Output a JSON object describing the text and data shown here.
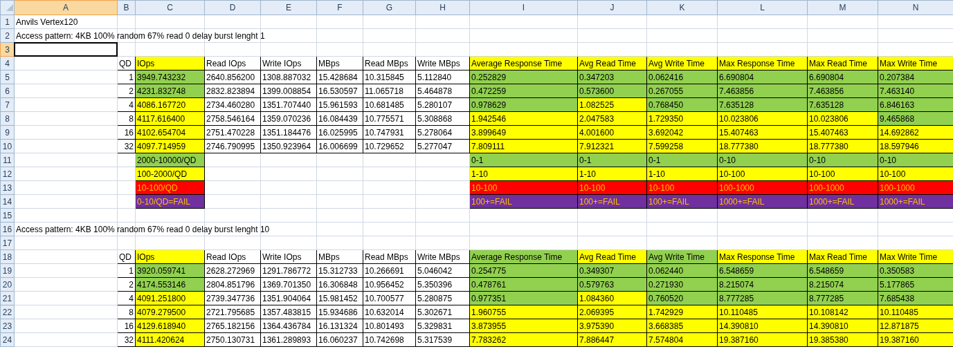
{
  "columns": [
    {
      "label": "A",
      "selected": true
    },
    {
      "label": "B",
      "selected": false
    },
    {
      "label": "C",
      "selected": false
    },
    {
      "label": "D",
      "selected": false
    },
    {
      "label": "E",
      "selected": false
    },
    {
      "label": "F",
      "selected": false
    },
    {
      "label": "G",
      "selected": false
    },
    {
      "label": "H",
      "selected": false
    },
    {
      "label": "I",
      "selected": false
    },
    {
      "label": "J",
      "selected": false
    },
    {
      "label": "K",
      "selected": false
    },
    {
      "label": "L",
      "selected": false
    },
    {
      "label": "M",
      "selected": false
    },
    {
      "label": "N",
      "selected": false
    }
  ],
  "rows": [
    {
      "label": "1",
      "selected": false,
      "cells": {
        "A": {
          "text": "Anvils Vertex120"
        }
      }
    },
    {
      "label": "2",
      "selected": false,
      "cells": {
        "A": {
          "text": "Access pattern: 4KB 100% random 67% read 0 delay burst lenght 1"
        }
      }
    },
    {
      "label": "3",
      "selected": true,
      "cells": {
        "A": {
          "selected": true
        }
      }
    },
    {
      "label": "4",
      "selected": false,
      "cells": {
        "B": {
          "text": "QD",
          "bordered": true
        },
        "C": {
          "text": "IOps",
          "bordered": true,
          "color": "#ffff00"
        },
        "D": {
          "text": "Read IOps",
          "bordered": true
        },
        "E": {
          "text": "Write IOps",
          "bordered": true
        },
        "F": {
          "text": "MBps",
          "bordered": true
        },
        "G": {
          "text": "Read MBps",
          "bordered": true
        },
        "H": {
          "text": "Write MBps",
          "bordered": true
        },
        "I": {
          "text": "Average Response Time",
          "bordered": true,
          "color": "#ffff00"
        },
        "J": {
          "text": "Avg Read Time",
          "bordered": true,
          "color": "#ffff00"
        },
        "K": {
          "text": "Avg Write Time",
          "bordered": true,
          "color": "#ffff00"
        },
        "L": {
          "text": "Max Response Time",
          "bordered": true,
          "color": "#ffff00"
        },
        "M": {
          "text": "Max Read Time",
          "bordered": true,
          "color": "#ffff00"
        },
        "N": {
          "text": "Max Write Time",
          "bordered": true,
          "color": "#ffff00"
        }
      }
    },
    {
      "label": "5",
      "selected": false,
      "cells": {
        "B": {
          "text": "1",
          "bordered": true,
          "kind": "number"
        },
        "C": {
          "text": "3949.743232",
          "bordered": true,
          "color": "#92d050"
        },
        "D": {
          "text": "2640.856200",
          "bordered": true
        },
        "E": {
          "text": "1308.887032",
          "bordered": true
        },
        "F": {
          "text": "15.428684",
          "bordered": true
        },
        "G": {
          "text": "10.315845",
          "bordered": true
        },
        "H": {
          "text": "5.112840",
          "bordered": true
        },
        "I": {
          "text": "0.252829",
          "bordered": true,
          "color": "#92d050"
        },
        "J": {
          "text": "0.347203",
          "bordered": true,
          "color": "#92d050"
        },
        "K": {
          "text": "0.062416",
          "bordered": true,
          "color": "#92d050"
        },
        "L": {
          "text": "6.690804",
          "bordered": true,
          "color": "#92d050"
        },
        "M": {
          "text": "6.690804",
          "bordered": true,
          "color": "#92d050"
        },
        "N": {
          "text": "0.207384",
          "bordered": true,
          "color": "#92d050"
        }
      }
    },
    {
      "label": "6",
      "selected": false,
      "cells": {
        "B": {
          "text": "2",
          "bordered": true,
          "kind": "number"
        },
        "C": {
          "text": "4231.832748",
          "bordered": true,
          "color": "#92d050"
        },
        "D": {
          "text": "2832.823894",
          "bordered": true
        },
        "E": {
          "text": "1399.008854",
          "bordered": true
        },
        "F": {
          "text": "16.530597",
          "bordered": true
        },
        "G": {
          "text": "11.065718",
          "bordered": true
        },
        "H": {
          "text": "5.464878",
          "bordered": true
        },
        "I": {
          "text": "0.472259",
          "bordered": true,
          "color": "#92d050"
        },
        "J": {
          "text": "0.573600",
          "bordered": true,
          "color": "#92d050"
        },
        "K": {
          "text": "0.267055",
          "bordered": true,
          "color": "#92d050"
        },
        "L": {
          "text": "7.463856",
          "bordered": true,
          "color": "#92d050"
        },
        "M": {
          "text": "7.463856",
          "bordered": true,
          "color": "#92d050"
        },
        "N": {
          "text": "7.463140",
          "bordered": true,
          "color": "#92d050"
        }
      }
    },
    {
      "label": "7",
      "selected": false,
      "cells": {
        "B": {
          "text": "4",
          "bordered": true,
          "kind": "number"
        },
        "C": {
          "text": "4086.167720",
          "bordered": true,
          "color": "#ffff00"
        },
        "D": {
          "text": "2734.460280",
          "bordered": true
        },
        "E": {
          "text": "1351.707440",
          "bordered": true
        },
        "F": {
          "text": "15.961593",
          "bordered": true
        },
        "G": {
          "text": "10.681485",
          "bordered": true
        },
        "H": {
          "text": "5.280107",
          "bordered": true
        },
        "I": {
          "text": "0.978629",
          "bordered": true,
          "color": "#92d050"
        },
        "J": {
          "text": "1.082525",
          "bordered": true,
          "color": "#ffff00"
        },
        "K": {
          "text": "0.768450",
          "bordered": true,
          "color": "#92d050"
        },
        "L": {
          "text": "7.635128",
          "bordered": true,
          "color": "#92d050"
        },
        "M": {
          "text": "7.635128",
          "bordered": true,
          "color": "#92d050"
        },
        "N": {
          "text": "6.846163",
          "bordered": true,
          "color": "#92d050"
        }
      }
    },
    {
      "label": "8",
      "selected": false,
      "cells": {
        "B": {
          "text": "8",
          "bordered": true,
          "kind": "number"
        },
        "C": {
          "text": "4117.616400",
          "bordered": true,
          "color": "#ffff00"
        },
        "D": {
          "text": "2758.546164",
          "bordered": true
        },
        "E": {
          "text": "1359.070236",
          "bordered": true
        },
        "F": {
          "text": "16.084439",
          "bordered": true
        },
        "G": {
          "text": "10.775571",
          "bordered": true
        },
        "H": {
          "text": "5.308868",
          "bordered": true
        },
        "I": {
          "text": "1.942546",
          "bordered": true,
          "color": "#ffff00"
        },
        "J": {
          "text": "2.047583",
          "bordered": true,
          "color": "#ffff00"
        },
        "K": {
          "text": "1.729350",
          "bordered": true,
          "color": "#ffff00"
        },
        "L": {
          "text": "10.023806",
          "bordered": true,
          "color": "#ffff00"
        },
        "M": {
          "text": "10.023806",
          "bordered": true,
          "color": "#ffff00"
        },
        "N": {
          "text": "9.465868",
          "bordered": true,
          "color": "#92d050"
        }
      }
    },
    {
      "label": "9",
      "selected": false,
      "cells": {
        "B": {
          "text": "16",
          "bordered": true,
          "kind": "number"
        },
        "C": {
          "text": "4102.654704",
          "bordered": true,
          "color": "#ffff00"
        },
        "D": {
          "text": "2751.470228",
          "bordered": true
        },
        "E": {
          "text": "1351.184476",
          "bordered": true
        },
        "F": {
          "text": "16.025995",
          "bordered": true
        },
        "G": {
          "text": "10.747931",
          "bordered": true
        },
        "H": {
          "text": "5.278064",
          "bordered": true
        },
        "I": {
          "text": "3.899649",
          "bordered": true,
          "color": "#ffff00"
        },
        "J": {
          "text": "4.001600",
          "bordered": true,
          "color": "#ffff00"
        },
        "K": {
          "text": "3.692042",
          "bordered": true,
          "color": "#ffff00"
        },
        "L": {
          "text": "15.407463",
          "bordered": true,
          "color": "#ffff00"
        },
        "M": {
          "text": "15.407463",
          "bordered": true,
          "color": "#ffff00"
        },
        "N": {
          "text": "14.692862",
          "bordered": true,
          "color": "#ffff00"
        }
      }
    },
    {
      "label": "10",
      "selected": false,
      "cells": {
        "B": {
          "text": "32",
          "bordered": true,
          "kind": "number"
        },
        "C": {
          "text": "4097.714959",
          "bordered": true,
          "color": "#ffff00"
        },
        "D": {
          "text": "2746.790995",
          "bordered": true
        },
        "E": {
          "text": "1350.923964",
          "bordered": true
        },
        "F": {
          "text": "16.006699",
          "bordered": true
        },
        "G": {
          "text": "10.729652",
          "bordered": true
        },
        "H": {
          "text": "5.277047",
          "bordered": true
        },
        "I": {
          "text": "7.809111",
          "bordered": true,
          "color": "#ffff00"
        },
        "J": {
          "text": "7.912321",
          "bordered": true,
          "color": "#ffff00"
        },
        "K": {
          "text": "7.599258",
          "bordered": true,
          "color": "#ffff00"
        },
        "L": {
          "text": "18.777380",
          "bordered": true,
          "color": "#ffff00"
        },
        "M": {
          "text": "18.777380",
          "bordered": true,
          "color": "#ffff00"
        },
        "N": {
          "text": "18.597946",
          "bordered": true,
          "color": "#ffff00"
        }
      }
    },
    {
      "label": "11",
      "selected": false,
      "cells": {
        "C": {
          "text": "2000-10000/QD",
          "bordered": true,
          "color": "#92d050"
        },
        "I": {
          "text": "0-1",
          "bordered": true,
          "color": "#92d050"
        },
        "J": {
          "text": "0-1",
          "bordered": true,
          "color": "#92d050"
        },
        "K": {
          "text": "0-1",
          "bordered": true,
          "color": "#92d050"
        },
        "L": {
          "text": "0-10",
          "bordered": true,
          "color": "#92d050"
        },
        "M": {
          "text": "0-10",
          "bordered": true,
          "color": "#92d050"
        },
        "N": {
          "text": "0-10",
          "bordered": true,
          "color": "#92d050"
        }
      }
    },
    {
      "label": "12",
      "selected": false,
      "cells": {
        "C": {
          "text": "100-2000/QD",
          "bordered": true,
          "color": "#ffff00"
        },
        "I": {
          "text": "1-10",
          "bordered": true,
          "color": "#ffff00"
        },
        "J": {
          "text": "1-10",
          "bordered": true,
          "color": "#ffff00"
        },
        "K": {
          "text": "1-10",
          "bordered": true,
          "color": "#ffff00"
        },
        "L": {
          "text": "10-100",
          "bordered": true,
          "color": "#ffff00"
        },
        "M": {
          "text": "10-100",
          "bordered": true,
          "color": "#ffff00"
        },
        "N": {
          "text": "10-100",
          "bordered": true,
          "color": "#ffff00"
        }
      }
    },
    {
      "label": "13",
      "selected": false,
      "cells": {
        "C": {
          "text": "10-100/QD",
          "bordered": true,
          "color": "#ff0000"
        },
        "I": {
          "text": "10-100",
          "bordered": true,
          "color": "#ff0000"
        },
        "J": {
          "text": "10-100",
          "bordered": true,
          "color": "#ff0000"
        },
        "K": {
          "text": "10-100",
          "bordered": true,
          "color": "#ff0000"
        },
        "L": {
          "text": "100-1000",
          "bordered": true,
          "color": "#ff0000"
        },
        "M": {
          "text": "100-1000",
          "bordered": true,
          "color": "#ff0000"
        },
        "N": {
          "text": "100-1000",
          "bordered": true,
          "color": "#ff0000"
        }
      }
    },
    {
      "label": "14",
      "selected": false,
      "cells": {
        "C": {
          "text": "0-10/QD=FAIL",
          "bordered": true,
          "color": "#7030a0"
        },
        "I": {
          "text": "100+=FAIL",
          "bordered": true,
          "color": "#7030a0"
        },
        "J": {
          "text": "100+=FAIL",
          "bordered": true,
          "color": "#7030a0"
        },
        "K": {
          "text": "100+=FAIL",
          "bordered": true,
          "color": "#7030a0"
        },
        "L": {
          "text": "1000+=FAIL",
          "bordered": true,
          "color": "#7030a0"
        },
        "M": {
          "text": "1000+=FAIL",
          "bordered": true,
          "color": "#7030a0"
        },
        "N": {
          "text": "1000+=FAIL",
          "bordered": true,
          "color": "#7030a0"
        }
      }
    },
    {
      "label": "15",
      "selected": false,
      "cells": {}
    },
    {
      "label": "16",
      "selected": false,
      "cells": {
        "A": {
          "text": "Access pattern: 4KB 100% random 67% read 0 delay burst lenght 10"
        }
      }
    },
    {
      "label": "17",
      "selected": false,
      "cells": {}
    },
    {
      "label": "18",
      "selected": false,
      "cells": {
        "B": {
          "text": "QD",
          "bordered": true
        },
        "C": {
          "text": "IOps",
          "bordered": true,
          "color": "#ffff00"
        },
        "D": {
          "text": "Read IOps",
          "bordered": true
        },
        "E": {
          "text": "Write IOps",
          "bordered": true
        },
        "F": {
          "text": "MBps",
          "bordered": true
        },
        "G": {
          "text": "Read MBps",
          "bordered": true
        },
        "H": {
          "text": "Write MBps",
          "bordered": true
        },
        "I": {
          "text": "Average Response Time",
          "bordered": true,
          "color": "#92d050"
        },
        "J": {
          "text": "Avg Read Time",
          "bordered": true,
          "color": "#ffff00"
        },
        "K": {
          "text": "Avg Write Time",
          "bordered": true,
          "color": "#92d050"
        },
        "L": {
          "text": "Max Response Time",
          "bordered": true,
          "color": "#ffff00"
        },
        "M": {
          "text": "Max Read Time",
          "bordered": true,
          "color": "#ffff00"
        },
        "N": {
          "text": "Max Write Time",
          "bordered": true,
          "color": "#ffff00"
        }
      }
    },
    {
      "label": "19",
      "selected": false,
      "cells": {
        "B": {
          "text": "1",
          "bordered": true,
          "kind": "number"
        },
        "C": {
          "text": "3920.059741",
          "bordered": true,
          "color": "#92d050"
        },
        "D": {
          "text": "2628.272969",
          "bordered": true
        },
        "E": {
          "text": "1291.786772",
          "bordered": true
        },
        "F": {
          "text": "15.312733",
          "bordered": true
        },
        "G": {
          "text": "10.266691",
          "bordered": true
        },
        "H": {
          "text": "5.046042",
          "bordered": true
        },
        "I": {
          "text": "0.254775",
          "bordered": true,
          "color": "#92d050"
        },
        "J": {
          "text": "0.349307",
          "bordered": true,
          "color": "#92d050"
        },
        "K": {
          "text": "0.062440",
          "bordered": true,
          "color": "#92d050"
        },
        "L": {
          "text": "6.548659",
          "bordered": true,
          "color": "#92d050"
        },
        "M": {
          "text": "6.548659",
          "bordered": true,
          "color": "#92d050"
        },
        "N": {
          "text": "0.350583",
          "bordered": true,
          "color": "#92d050"
        }
      }
    },
    {
      "label": "20",
      "selected": false,
      "cells": {
        "B": {
          "text": "2",
          "bordered": true,
          "kind": "number"
        },
        "C": {
          "text": "4174.553146",
          "bordered": true,
          "color": "#92d050"
        },
        "D": {
          "text": "2804.851796",
          "bordered": true
        },
        "E": {
          "text": "1369.701350",
          "bordered": true
        },
        "F": {
          "text": "16.306848",
          "bordered": true
        },
        "G": {
          "text": "10.956452",
          "bordered": true
        },
        "H": {
          "text": "5.350396",
          "bordered": true
        },
        "I": {
          "text": "0.478761",
          "bordered": true,
          "color": "#92d050"
        },
        "J": {
          "text": "0.579763",
          "bordered": true,
          "color": "#92d050"
        },
        "K": {
          "text": "0.271930",
          "bordered": true,
          "color": "#92d050"
        },
        "L": {
          "text": "8.215074",
          "bordered": true,
          "color": "#92d050"
        },
        "M": {
          "text": "8.215074",
          "bordered": true,
          "color": "#92d050"
        },
        "N": {
          "text": "5.177865",
          "bordered": true,
          "color": "#92d050"
        }
      }
    },
    {
      "label": "21",
      "selected": false,
      "cells": {
        "B": {
          "text": "4",
          "bordered": true,
          "kind": "number"
        },
        "C": {
          "text": "4091.251800",
          "bordered": true,
          "color": "#ffff00"
        },
        "D": {
          "text": "2739.347736",
          "bordered": true
        },
        "E": {
          "text": "1351.904064",
          "bordered": true
        },
        "F": {
          "text": "15.981452",
          "bordered": true
        },
        "G": {
          "text": "10.700577",
          "bordered": true
        },
        "H": {
          "text": "5.280875",
          "bordered": true
        },
        "I": {
          "text": "0.977351",
          "bordered": true,
          "color": "#92d050"
        },
        "J": {
          "text": "1.084360",
          "bordered": true,
          "color": "#ffff00"
        },
        "K": {
          "text": "0.760520",
          "bordered": true,
          "color": "#92d050"
        },
        "L": {
          "text": "8.777285",
          "bordered": true,
          "color": "#92d050"
        },
        "M": {
          "text": "8.777285",
          "bordered": true,
          "color": "#92d050"
        },
        "N": {
          "text": "7.685438",
          "bordered": true,
          "color": "#92d050"
        }
      }
    },
    {
      "label": "22",
      "selected": false,
      "cells": {
        "B": {
          "text": "8",
          "bordered": true,
          "kind": "number"
        },
        "C": {
          "text": "4079.279500",
          "bordered": true,
          "color": "#ffff00"
        },
        "D": {
          "text": "2721.795685",
          "bordered": true
        },
        "E": {
          "text": "1357.483815",
          "bordered": true
        },
        "F": {
          "text": "15.934686",
          "bordered": true
        },
        "G": {
          "text": "10.632014",
          "bordered": true
        },
        "H": {
          "text": "5.302671",
          "bordered": true
        },
        "I": {
          "text": "1.960755",
          "bordered": true,
          "color": "#ffff00"
        },
        "J": {
          "text": "2.069395",
          "bordered": true,
          "color": "#ffff00"
        },
        "K": {
          "text": "1.742929",
          "bordered": true,
          "color": "#ffff00"
        },
        "L": {
          "text": "10.110485",
          "bordered": true,
          "color": "#ffff00"
        },
        "M": {
          "text": "10.108142",
          "bordered": true,
          "color": "#ffff00"
        },
        "N": {
          "text": "10.110485",
          "bordered": true,
          "color": "#ffff00"
        }
      }
    },
    {
      "label": "23",
      "selected": false,
      "cells": {
        "B": {
          "text": "16",
          "bordered": true,
          "kind": "number"
        },
        "C": {
          "text": "4129.618940",
          "bordered": true,
          "color": "#ffff00"
        },
        "D": {
          "text": "2765.182156",
          "bordered": true
        },
        "E": {
          "text": "1364.436784",
          "bordered": true
        },
        "F": {
          "text": "16.131324",
          "bordered": true
        },
        "G": {
          "text": "10.801493",
          "bordered": true
        },
        "H": {
          "text": "5.329831",
          "bordered": true
        },
        "I": {
          "text": "3.873955",
          "bordered": true,
          "color": "#ffff00"
        },
        "J": {
          "text": "3.975390",
          "bordered": true,
          "color": "#ffff00"
        },
        "K": {
          "text": "3.668385",
          "bordered": true,
          "color": "#ffff00"
        },
        "L": {
          "text": "14.390810",
          "bordered": true,
          "color": "#ffff00"
        },
        "M": {
          "text": "14.390810",
          "bordered": true,
          "color": "#ffff00"
        },
        "N": {
          "text": "12.871875",
          "bordered": true,
          "color": "#ffff00"
        }
      }
    },
    {
      "label": "24",
      "selected": false,
      "cells": {
        "B": {
          "text": "32",
          "bordered": true,
          "kind": "number"
        },
        "C": {
          "text": "4111.420624",
          "bordered": true,
          "color": "#ffff00"
        },
        "D": {
          "text": "2750.130731",
          "bordered": true
        },
        "E": {
          "text": "1361.289893",
          "bordered": true
        },
        "F": {
          "text": "16.060237",
          "bordered": true
        },
        "G": {
          "text": "10.742698",
          "bordered": true
        },
        "H": {
          "text": "5.317539",
          "bordered": true
        },
        "I": {
          "text": "7.783262",
          "bordered": true,
          "color": "#ffff00"
        },
        "J": {
          "text": "7.886447",
          "bordered": true,
          "color": "#ffff00"
        },
        "K": {
          "text": "7.574804",
          "bordered": true,
          "color": "#ffff00"
        },
        "L": {
          "text": "19.387160",
          "bordered": true,
          "color": "#ffff00"
        },
        "M": {
          "text": "19.385380",
          "bordered": true,
          "color": "#ffff00"
        },
        "N": {
          "text": "19.387160",
          "bordered": true,
          "color": "#ffff00"
        }
      }
    }
  ]
}
